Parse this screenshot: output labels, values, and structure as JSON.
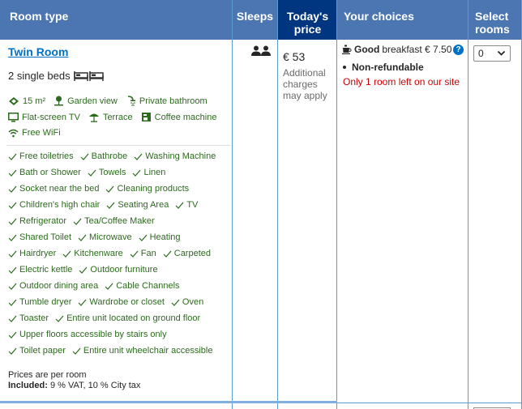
{
  "header": {
    "room_type": "Room type",
    "sleeps": "Sleeps",
    "price_line1": "Today's",
    "price_line2": "price",
    "choices": "Your choices",
    "select_line1": "Select",
    "select_line2": "rooms"
  },
  "room": {
    "name": "Twin Room",
    "beds": "2 single beds",
    "facilities_row1": [
      "15 m²",
      "Garden view",
      "Private bathroom"
    ],
    "facilities_row2": [
      "Flat-screen TV",
      "Terrace",
      "Coffee machine"
    ],
    "facilities_row3": [
      "Free WiFi"
    ],
    "amenities": [
      [
        "Free toiletries",
        "Bathrobe",
        "Washing Machine"
      ],
      [
        "Bath or Shower",
        "Towels",
        "Linen"
      ],
      [
        "Socket near the bed",
        "Cleaning products"
      ],
      [
        "Children's high chair",
        "Seating Area",
        "TV"
      ],
      [
        "Refrigerator",
        "Tea/Coffee Maker"
      ],
      [
        "Shared Toilet",
        "Microwave",
        "Heating"
      ],
      [
        "Hairdryer",
        "Kitchenware",
        "Fan",
        "Carpeted"
      ],
      [
        "Electric kettle",
        "Outdoor furniture"
      ],
      [
        "Outdoor dining area",
        "Cable Channels"
      ],
      [
        "Tumble dryer",
        "Wardrobe or closet",
        "Oven"
      ],
      [
        "Toaster",
        "Entire unit located on ground floor"
      ],
      [
        "Upper floors accessible by stairs only"
      ],
      [
        "Toilet paper",
        "Entire unit wheelchair accessible"
      ]
    ],
    "price_note": "Prices are per room",
    "included_label": "Included:",
    "included_text": "9 % VAT, 10 % City tax"
  },
  "price": {
    "amount": "€ 53",
    "charges": "Additional charges may apply"
  },
  "choices": {
    "breakfast_good": "Good",
    "breakfast_text": "breakfast € 7.50",
    "help": "?",
    "nonrefundable": "Non-refundable",
    "availability": "Only 1 room left on our site"
  },
  "select": {
    "value": "0"
  },
  "colors": {
    "header_bg": "#4c76b2",
    "price_header_bg": "#003580",
    "link": "#0071c2",
    "facility_green": "#2d6a1f",
    "urgency_red": "#cc0000"
  }
}
